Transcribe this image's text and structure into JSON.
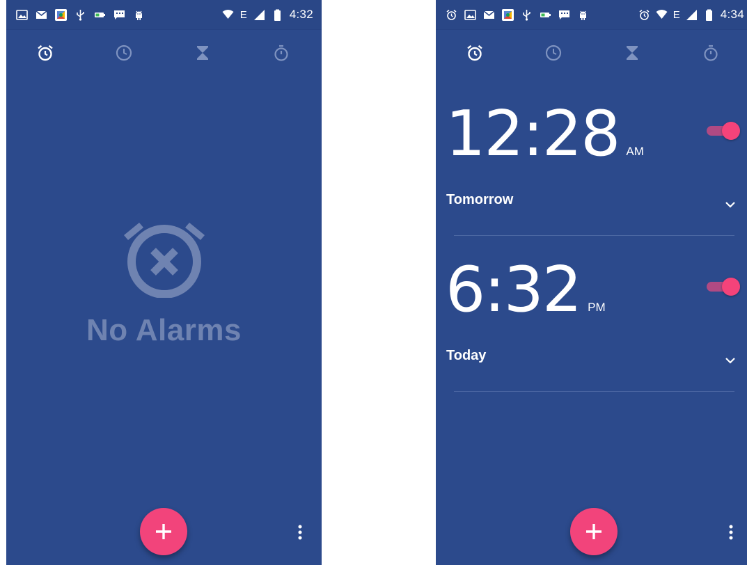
{
  "colors": {
    "background": "#2c4a8c",
    "accent": "#f2447b",
    "empty_text": "#6f83b1",
    "tab_inactive": "#7f93c0",
    "tab_active": "#ffffff"
  },
  "screens": [
    {
      "status_bar": {
        "left_icons": [
          "image-icon",
          "mail-icon",
          "photos-app-icon",
          "usb-icon",
          "battery-saver-icon",
          "message-icon",
          "android-debug-icon"
        ],
        "right_icons": [
          "wifi-icon",
          "signal-icon",
          "battery-icon"
        ],
        "network": "E",
        "time": "4:32"
      },
      "tabs": [
        {
          "icon": "alarm-icon",
          "active": true
        },
        {
          "icon": "clock-icon",
          "active": false
        },
        {
          "icon": "timer-icon",
          "active": false
        },
        {
          "icon": "stopwatch-icon",
          "active": false
        }
      ],
      "empty_state": {
        "icon": "alarm-off-icon",
        "text": "No Alarms"
      },
      "fab": {
        "icon": "plus-icon"
      },
      "overflow": {
        "icon": "more-vert-icon"
      }
    },
    {
      "status_bar": {
        "left_icons": [
          "alarm-icon",
          "image-icon",
          "mail-icon",
          "photos-app-icon",
          "usb-icon",
          "battery-saver-icon",
          "message-icon",
          "android-debug-icon"
        ],
        "right_icons": [
          "alarm-icon",
          "wifi-icon",
          "signal-icon",
          "battery-icon"
        ],
        "network": "E",
        "time": "4:34"
      },
      "tabs": [
        {
          "icon": "alarm-icon",
          "active": true
        },
        {
          "icon": "clock-icon",
          "active": false
        },
        {
          "icon": "timer-icon",
          "active": false
        },
        {
          "icon": "stopwatch-icon",
          "active": false
        }
      ],
      "alarms": [
        {
          "time": "12:28",
          "ampm": "AM",
          "enabled": true,
          "label": "Tomorrow"
        },
        {
          "time": "6:32",
          "ampm": "PM",
          "enabled": true,
          "label": "Today"
        }
      ],
      "fab": {
        "icon": "plus-icon"
      },
      "overflow": {
        "icon": "more-vert-icon"
      }
    }
  ]
}
